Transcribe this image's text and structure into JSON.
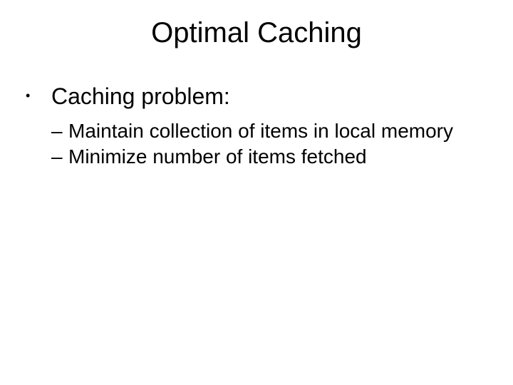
{
  "title": "Optimal Caching",
  "bullets": {
    "level1": {
      "item0": "Caching problem:"
    },
    "level2": {
      "item0": "Maintain collection of items in local memory",
      "item1": "Minimize number of items fetched"
    }
  }
}
